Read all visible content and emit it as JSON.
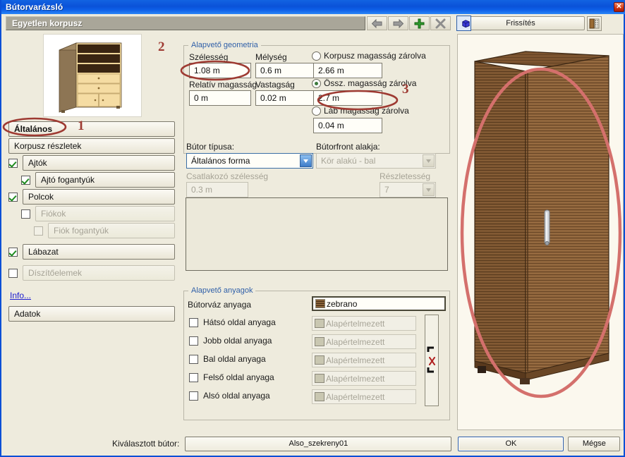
{
  "window": {
    "title": "Bútorvarázsló",
    "close_icon": "close-icon"
  },
  "header": {
    "section_title": "Egyetlen korpusz",
    "nav": [
      {
        "name": "back-button",
        "icon": "arrow-left-icon"
      },
      {
        "name": "forward-button",
        "icon": "arrow-right-icon"
      },
      {
        "name": "add-button",
        "icon": "plus-icon"
      },
      {
        "name": "delete-button",
        "icon": "cross-icon"
      }
    ],
    "update_label": "Frissítés",
    "texture_icon": "texture-view-icon",
    "solid_icon": "solid-view-icon"
  },
  "sidebar": {
    "thumbnail": "furniture-thumbnail",
    "items": [
      {
        "label": "Általános",
        "type": "button",
        "enabled": true,
        "bold": true
      },
      {
        "label": "Korpusz részletek",
        "type": "button",
        "enabled": true,
        "bold": false
      },
      {
        "label": "Ajtók",
        "type": "checkbox",
        "checked": true,
        "enabled": true,
        "indent": 0
      },
      {
        "label": "Ajtó fogantyúk",
        "type": "checkbox",
        "checked": true,
        "enabled": true,
        "indent": 1
      },
      {
        "label": "Polcok",
        "type": "checkbox",
        "checked": true,
        "enabled": true,
        "indent": 0
      },
      {
        "label": "Fiókok",
        "type": "checkbox",
        "checked": false,
        "enabled": false,
        "indent": 1
      },
      {
        "label": "Fiók fogantyúk",
        "type": "checkbox",
        "checked": false,
        "enabled": false,
        "indent": 2
      },
      {
        "label": "Lábazat",
        "type": "checkbox",
        "checked": true,
        "enabled": true,
        "indent": 0
      },
      {
        "label": "Díszítőelemek",
        "type": "checkbox",
        "checked": false,
        "enabled": false,
        "indent": 0
      }
    ],
    "info_link": "Info...",
    "data_button": "Adatok"
  },
  "geometry": {
    "legend": "Alapvető geometria",
    "width_label": "Szélesség",
    "width_value": "1.08 m",
    "depth_label": "Mélység",
    "depth_value": "0.6 m",
    "relative_height_label": "Relatív magasság",
    "relative_height_value": "0 m",
    "thickness_label": "Vastagság",
    "thickness_value": "0.02 m",
    "lock_body_label": "Korpusz magasság zárolva",
    "lock_body_value": "2.66 m",
    "lock_body_selected": false,
    "lock_total_label": "Össz. magasság zárolva",
    "lock_total_value": "2.7 m",
    "lock_total_selected": true,
    "lock_leg_label": "Láb magasság zárolva",
    "lock_leg_value": "0.04 m",
    "lock_leg_selected": false,
    "furniture_type_label": "Bútor típusa:",
    "furniture_type_value": "Általános forma",
    "front_shape_label": "Bútorfront alakja:",
    "front_shape_value": "Kör alakú - bal",
    "connector_width_label": "Csatlakozó szélesség",
    "connector_width_value": "0.3 m",
    "detail_label": "Részletesség",
    "detail_value": "7"
  },
  "materials": {
    "legend": "Alapvető anyagok",
    "frame_label": "Bútorváz anyaga",
    "frame_value": "zebrano",
    "frame_swatch": "#6b4a2a",
    "rows": [
      {
        "label": "Hátsó oldal anyaga",
        "value": "Alapértelmezett",
        "checked": false
      },
      {
        "label": "Jobb oldal anyaga",
        "value": "Alapértelmezett",
        "checked": false
      },
      {
        "label": "Bal oldal anyaga",
        "value": "Alapértelmezett",
        "checked": false
      },
      {
        "label": "Felső oldal anyaga",
        "value": "Alapértelmezett",
        "checked": false
      },
      {
        "label": "Alsó oldal anyaga",
        "value": "Alapértelmezett",
        "checked": false
      }
    ],
    "side_icon": "delete-material-icon"
  },
  "preview": {
    "name": "furniture-3d-preview",
    "object": "wardrobe-cabinet"
  },
  "footer": {
    "selected_label": "Kiválasztott bútor:",
    "selected_value": "Also_szekreny01",
    "ok_label": "OK",
    "cancel_label": "Mégse"
  },
  "annotations": {
    "accent_color": "#9e3a32",
    "marks": [
      {
        "number": "1",
        "target": "altalanos-button"
      },
      {
        "number": "2",
        "target": "width-field"
      },
      {
        "number": "3",
        "target": "total-height-field"
      }
    ]
  }
}
